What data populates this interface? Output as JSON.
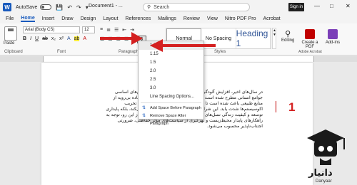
{
  "titlebar": {
    "app_icon": "W",
    "autosave_label": "AutoSave",
    "doc_title": "Document1 - ...",
    "search_placeholder": "Search",
    "sign_in": "Sign in",
    "icons": [
      "save-icon",
      "undo-icon",
      "redo-icon",
      "customize-icon",
      "search-icon",
      "minimize-icon",
      "maximize-icon",
      "close-icon"
    ]
  },
  "tabs": [
    "File",
    "Home",
    "Insert",
    "Draw",
    "Design",
    "Layout",
    "References",
    "Mailings",
    "Review",
    "View",
    "Nitro PDF Pro",
    "Acrobat"
  ],
  "ribbon": {
    "paste_label": "Paste",
    "clipboard_label": "Clipboard",
    "font_name": "Arial (Body CS)",
    "font_size": "12",
    "font_label": "Font",
    "paragraph_label": "Paragraph",
    "styles_label": "Styles",
    "styles": [
      {
        "sample": "Normal",
        "label": ""
      },
      {
        "sample": "No Spacing",
        "label": ""
      },
      {
        "sample": "Heading 1",
        "label": ""
      }
    ],
    "editing_label": "Editing",
    "create_pdf_label": "Create a PDF",
    "addins_label": "Add-ins",
    "adobe_label": "Adobe Acrobat"
  },
  "line_spacing_menu": {
    "options": [
      "1.0",
      "1.15",
      "1.5",
      "2.0",
      "2.5",
      "3.0"
    ],
    "more_options": "Line Spacing Options...",
    "add_space": "Add Space Before Paragraph",
    "remove_space": "Remove Space After Paragraph"
  },
  "document": {
    "text": "در سال‌های اخیر، افزایش آلودگی‌های زیست‌محیطی به یکی از چالش‌های اساسی جوامع انسانی مطرح شده است. رشد جمعیت، توسعه صنعتی و استفاده بی‌رویه از منابع طبیعی باعث شده است تا سطح آلودگی هوا، کاهش منابع آب و تخریب اکوسیستم‌ها شدت یابد. این شرایط نه تنها سلامت انسان را تهدید می‌کند، بلکه پایداری توسعه و کیفیت زندگی نسل‌های آینده را نیز تحت تأثیر قرار می‌دهد. از این رو، توجه به راهکارهای پایدار محیط‌زیست و بهرگیری از سیاست‌های مؤثر حفاظتی، ضرورتی اجتناب‌ناپذیر محسوب می‌شود.",
    "annotation_number": "1"
  },
  "logo": {
    "title": "دانیار",
    "subtitle": "Danyaar"
  },
  "colors": {
    "accent": "#185abd",
    "annotation": "#d42020"
  }
}
